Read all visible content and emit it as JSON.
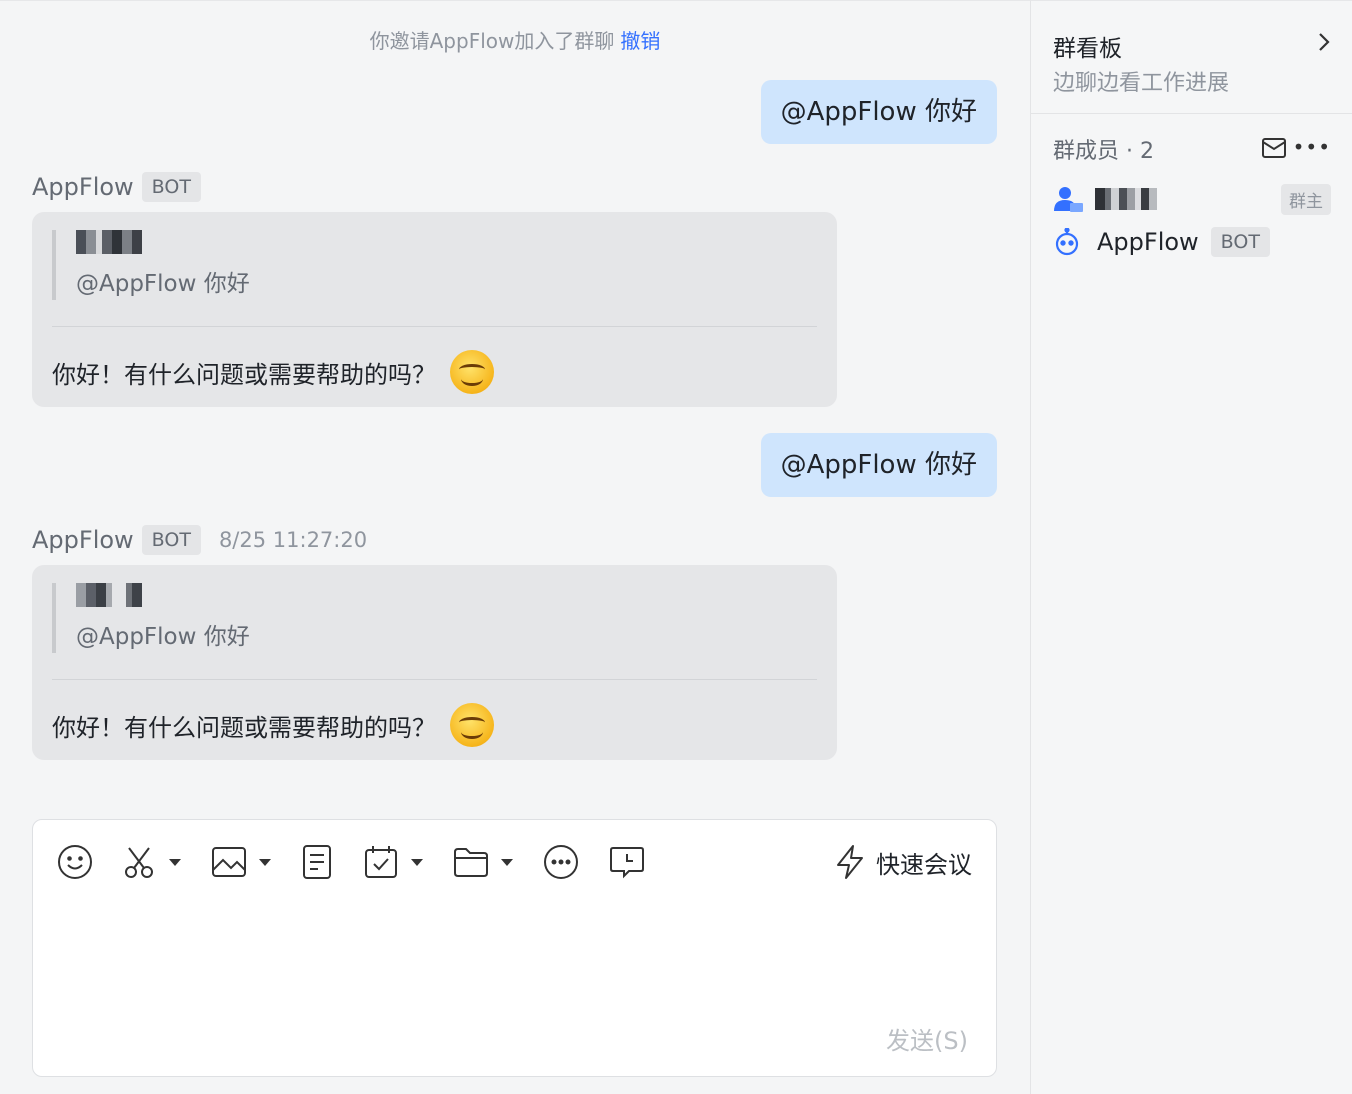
{
  "system_message": {
    "text": "你邀请AppFlow加入了群聊",
    "action": "撤销"
  },
  "messages": [
    {
      "type": "outgoing",
      "text": "@AppFlow 你好"
    },
    {
      "type": "bot",
      "sender": "AppFlow",
      "tag": "BOT",
      "time": "",
      "quote_text": "@AppFlow  你好",
      "reply": "你好！有什么问题或需要帮助的吗？"
    },
    {
      "type": "outgoing",
      "text": "@AppFlow 你好"
    },
    {
      "type": "bot",
      "sender": "AppFlow",
      "tag": "BOT",
      "time": "8/25 11:27:20",
      "quote_text": "@AppFlow  你好",
      "reply": "你好！有什么问题或需要帮助的吗？"
    }
  ],
  "composer": {
    "quick_meeting": "快速会议",
    "send": "发送(S)"
  },
  "sidebar": {
    "board_title": "群看板",
    "board_subtitle": "边聊边看工作进展",
    "members_title": "群成员 · 2",
    "owner_tag": "群主",
    "bot_member": {
      "name": "AppFlow",
      "tag": "BOT"
    }
  },
  "colors": {
    "accent": "#3370ff",
    "outgoing_bubble": "#cfe5fd",
    "bot_card": "#e5e6e8"
  }
}
